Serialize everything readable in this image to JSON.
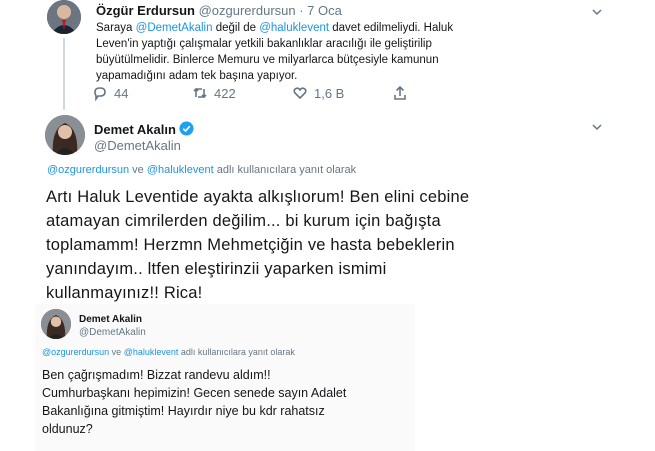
{
  "tweet1": {
    "name": "Özgür Erdursun",
    "handle": "@ozgurerdursun",
    "sep": " · ",
    "date": "7 Oca",
    "text_parts": {
      "p1": "Saraya ",
      "m1": "@DemetAkalin",
      "p2": " değil de ",
      "m2": "@haluklevent",
      "p3": " davet edilmeliydi. Haluk"
    },
    "line2": "Leven'in yaptığı çalışmalar yetkili bakanlıklar aracılığı ile geliştirilip",
    "line3": "büyütülmelidir. Binlerce Memuru ve milyarlarca bütçesiyle kamunun",
    "line4": "yapamadığını adam tek başına yapıyor.",
    "replies": "44",
    "retweets": "422",
    "likes": "1,6 B"
  },
  "tweet2": {
    "name": "Demet Akalın",
    "handle": "@DemetAkalin",
    "reply_to_m1": "@ozgurerdursun",
    "reply_to_and": " ve ",
    "reply_to_m2": "@haluklevent",
    "reply_to_suffix": " adlı kullanıcılara yanıt olarak",
    "lines": [
      "Artı Haluk Leventide ayakta alkışlıorum! Ben elini cebine",
      "atamayan cimrilerden değilim... bi kurum için bağışta",
      "toplamamm! Herzmn Mehmetçiğin ve hasta bebeklerin",
      "yanındayım.. ltfen eleştirinzii yaparken ismimi",
      "kullanmayınız!! Rica!"
    ]
  },
  "tweet3": {
    "name": "Demet Akalin",
    "handle": "@DemetAkalin",
    "reply_to_m1": "@ozgurerdursun",
    "reply_to_and": " ve ",
    "reply_to_m2": "@haluklevent",
    "reply_to_suffix": " adlı kullanıcılara yanıt olarak",
    "lines": [
      "Ben çağrışmadım! Bizzat randevu aldım!!",
      "Cumhurbaşkanı hepimizin! Gecen senede sayın Adalet",
      "Bakanlığına gitmiştim! Hayırdır niye bu kdr rahatsız",
      "oldunuz?"
    ]
  },
  "colors": {
    "link": "#1b95e0",
    "muted": "#657786",
    "verified": "#1da1f2"
  },
  "icons": [
    "reply-icon",
    "retweet-icon",
    "like-icon",
    "share-icon",
    "chevron-down-icon",
    "verified-badge-icon"
  ]
}
